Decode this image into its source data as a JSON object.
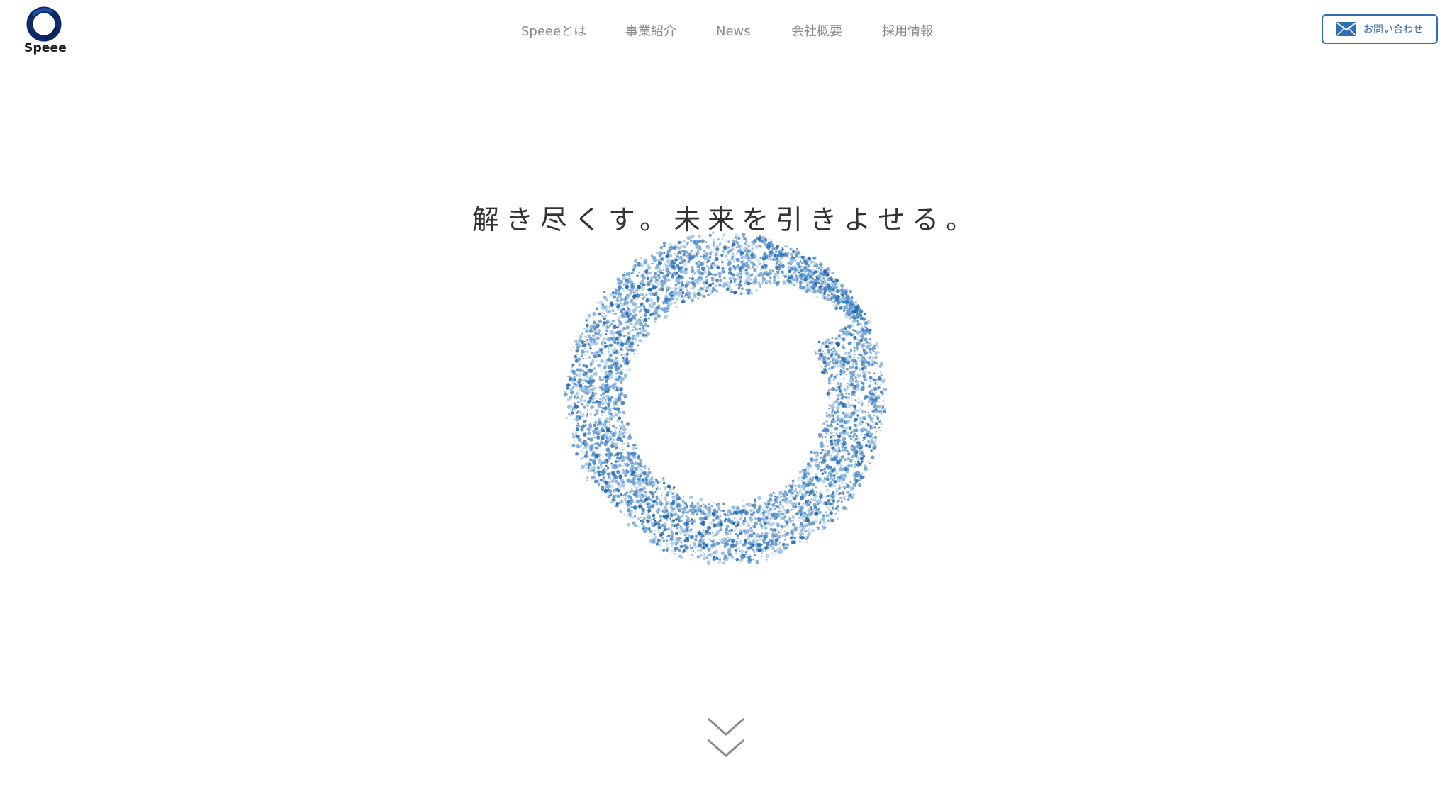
{
  "header": {
    "logo": {
      "text": "Speee",
      "icon": "speee-ring-logo",
      "color": "#0d2b6b"
    },
    "nav": [
      {
        "label": "Speeeとは"
      },
      {
        "label": "事業紹介"
      },
      {
        "label": "News"
      },
      {
        "label": "会社概要"
      },
      {
        "label": "採用情報"
      }
    ],
    "contact": {
      "label": "お問い合わせ",
      "icon": "mail-icon",
      "color": "#2f6db4"
    }
  },
  "hero": {
    "tagline": "解き尽くす。未来を引きよせる。",
    "visual": {
      "icon": "particle-ring",
      "color": "#4a8ac9"
    }
  },
  "scroll": {
    "icon": "double-chevron-down-icon",
    "color": "#8c8c8c"
  }
}
